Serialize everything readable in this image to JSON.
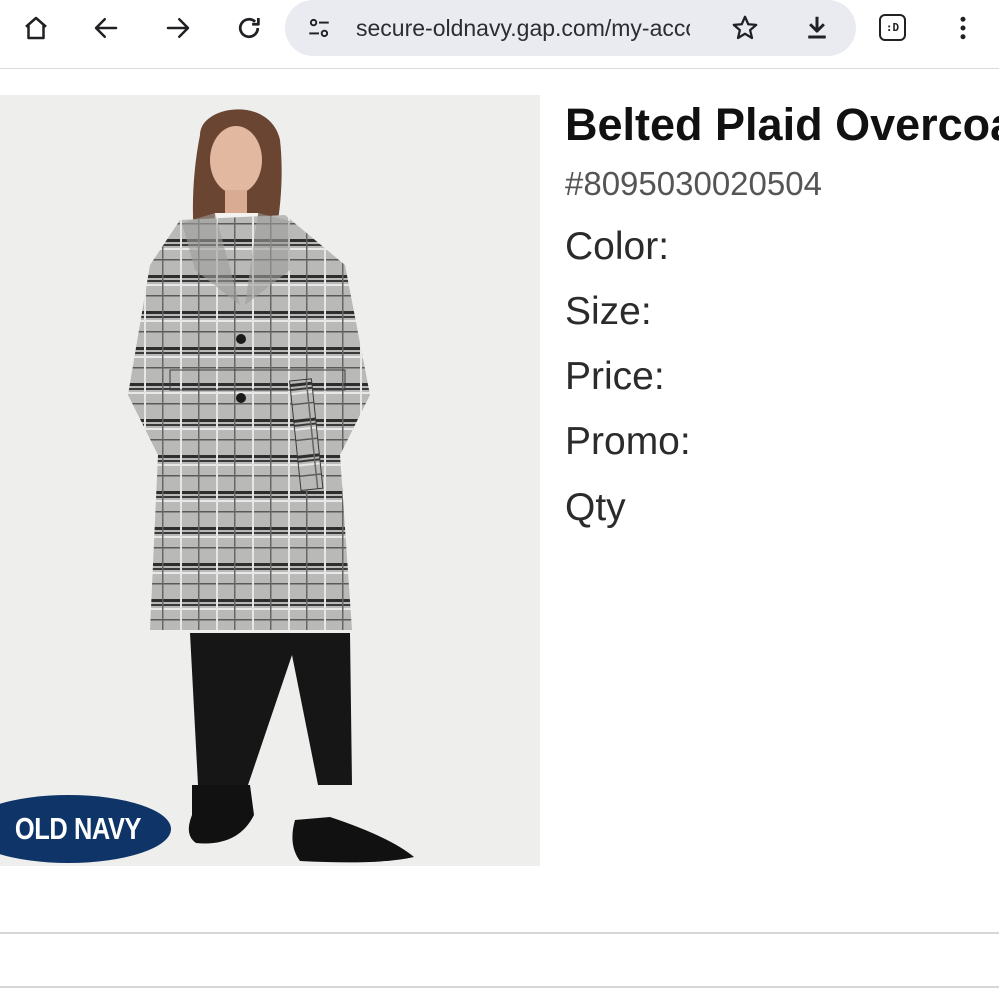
{
  "browser": {
    "url": "secure-oldnavy.gap.com/my-account",
    "tab_count_label": ":D",
    "icons": {
      "home": "home-icon",
      "back": "arrow-left-icon",
      "forward": "arrow-right-icon",
      "reload": "reload-icon",
      "site_settings": "tune-icon",
      "bookmark": "star-icon",
      "download": "download-icon",
      "tabs": "tab-switcher-icon",
      "menu": "more-vert-icon"
    }
  },
  "product": {
    "title": "Belted Plaid Overcoat",
    "sku": "#8095030020504",
    "brand_logo": "OLD NAVY",
    "attributes": {
      "color_label": "Color:",
      "size_label": "Size:",
      "price_label": "Price:",
      "promo_label": "Promo:",
      "qty_label": "Qty"
    }
  },
  "colors": {
    "toolbar_bg": "#ffffff",
    "omnibox_bg": "#e9ebf0",
    "brand_navy": "#0f3568",
    "title_text": "#111111",
    "sku_text": "#555555"
  }
}
